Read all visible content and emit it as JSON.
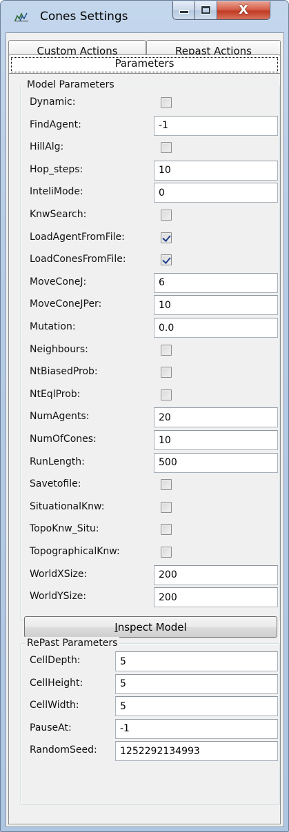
{
  "window": {
    "title": "Cones Settings",
    "app_icon": "chart-icon",
    "controls": {
      "minimize_icon": "minimize-icon",
      "maximize_icon": "maximize-icon",
      "close_icon": "close-icon",
      "close_glyph": "X"
    }
  },
  "tabs": {
    "custom_actions": "Custom Actions",
    "repast_actions": "Repast Actions",
    "parameters": "Parameters"
  },
  "model_parameters": {
    "legend": "Model Parameters",
    "rows": [
      {
        "label": "Dynamic:",
        "type": "checkbox",
        "checked": false
      },
      {
        "label": "FindAgent:",
        "type": "text",
        "value": "-1"
      },
      {
        "label": "HillAlg:",
        "type": "checkbox",
        "checked": false
      },
      {
        "label": "Hop_steps:",
        "type": "text",
        "value": "10"
      },
      {
        "label": "InteliMode:",
        "type": "text",
        "value": "0"
      },
      {
        "label": "KnwSearch:",
        "type": "checkbox",
        "checked": false
      },
      {
        "label": "LoadAgentFromFile:",
        "type": "checkbox",
        "checked": true
      },
      {
        "label": "LoadConesFromFile:",
        "type": "checkbox",
        "checked": true
      },
      {
        "label": "MoveConeJ:",
        "type": "text",
        "value": "6"
      },
      {
        "label": "MoveConeJPer:",
        "type": "text",
        "value": "10"
      },
      {
        "label": "Mutation:",
        "type": "text",
        "value": "0.0"
      },
      {
        "label": "Neighbours:",
        "type": "checkbox",
        "checked": false
      },
      {
        "label": "NtBiasedProb:",
        "type": "checkbox",
        "checked": false
      },
      {
        "label": "NtEqlProb:",
        "type": "checkbox",
        "checked": false
      },
      {
        "label": "NumAgents:",
        "type": "text",
        "value": "20"
      },
      {
        "label": "NumOfCones:",
        "type": "text",
        "value": "10"
      },
      {
        "label": "RunLength:",
        "type": "text",
        "value": "500"
      },
      {
        "label": "Savetofile:",
        "type": "checkbox",
        "checked": false
      },
      {
        "label": "SituationalKnw:",
        "type": "checkbox",
        "checked": false
      },
      {
        "label": "TopoKnw_Situ:",
        "type": "checkbox",
        "checked": false
      },
      {
        "label": "TopographicalKnw:",
        "type": "checkbox",
        "checked": false
      },
      {
        "label": "WorldXSize:",
        "type": "text",
        "value": "200"
      },
      {
        "label": "WorldYSize:",
        "type": "text",
        "value": "200"
      }
    ],
    "inspect_button": {
      "mnemonic": "I",
      "rest": "nspect Model"
    }
  },
  "repast_parameters": {
    "legend": "RePast Parameters",
    "rows": [
      {
        "label": "CellDepth:",
        "type": "text",
        "value": "5"
      },
      {
        "label": "CellHeight:",
        "type": "text",
        "value": "5"
      },
      {
        "label": "CellWidth:",
        "type": "text",
        "value": "5"
      },
      {
        "label": "PauseAt:",
        "type": "text",
        "value": "-1"
      },
      {
        "label": "RandomSeed:",
        "type": "text",
        "value": "1252292134993"
      }
    ]
  }
}
